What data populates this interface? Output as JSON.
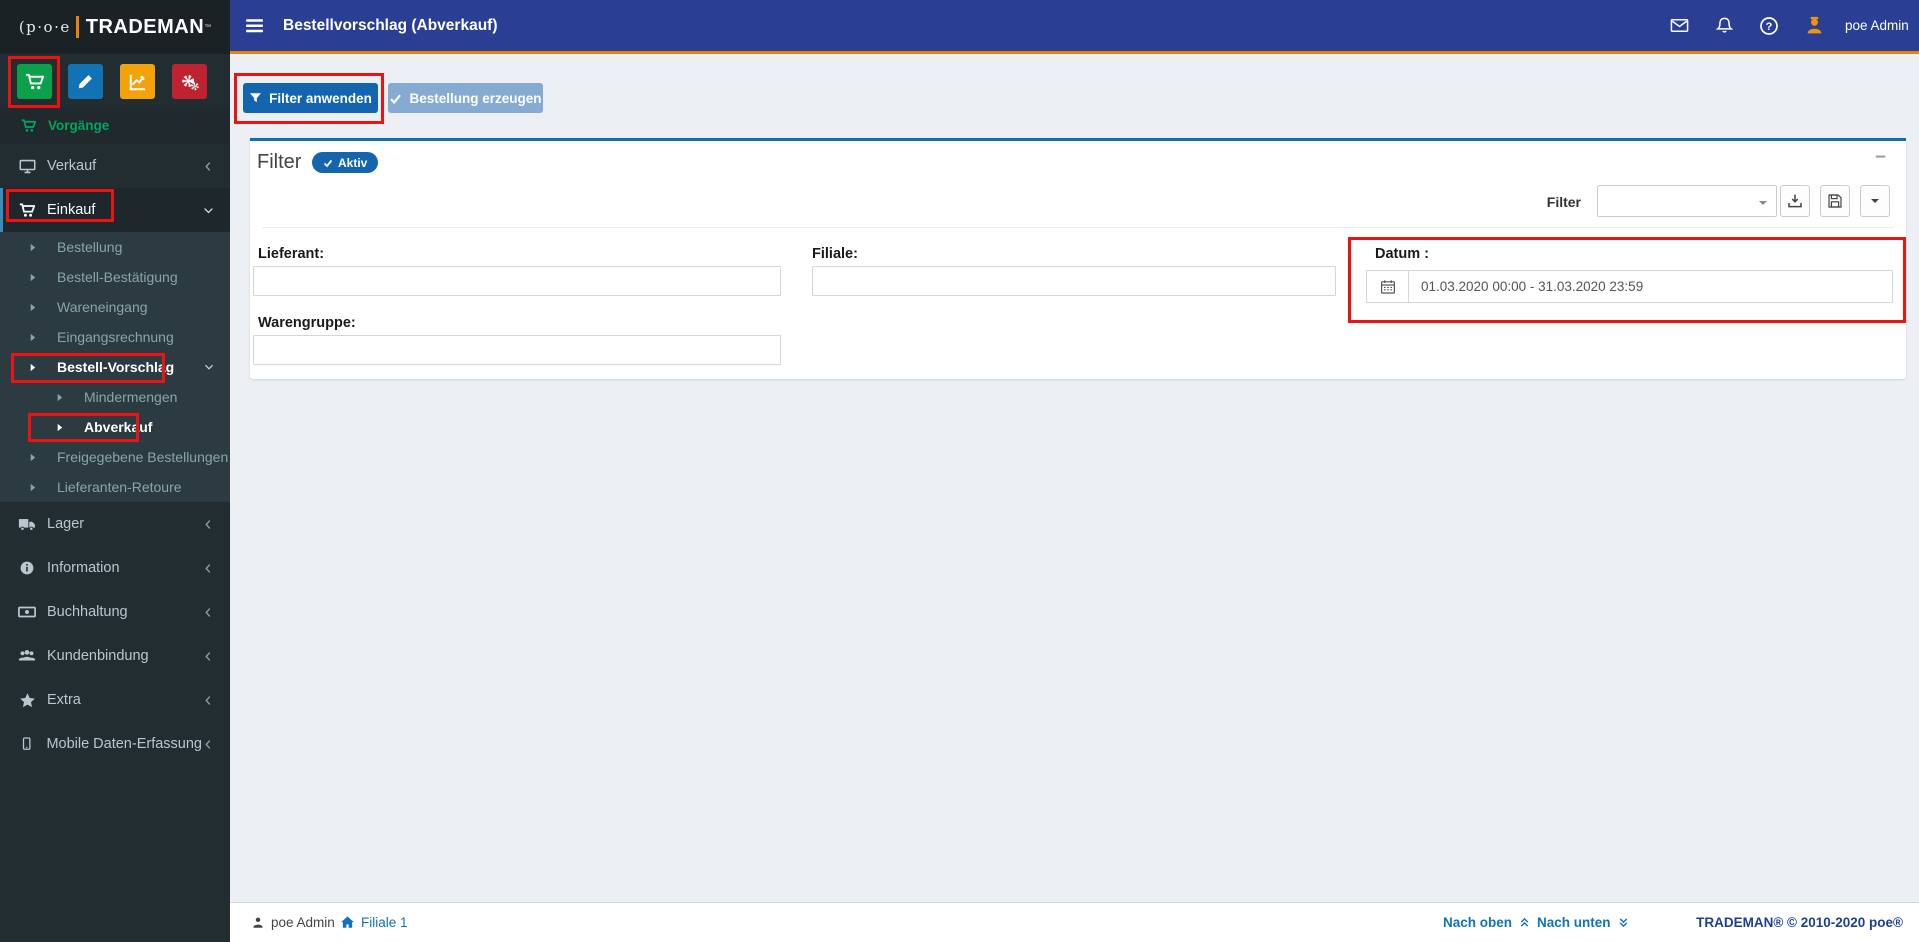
{
  "logo": {
    "mark": "(p·o·e",
    "name": "TRADEMAN",
    "tm": "™"
  },
  "topbar": {
    "title": "Bestellvorschlag (Abverkauf)",
    "user": "poe Admin"
  },
  "sidebar": {
    "section": "Vorgänge",
    "items": [
      {
        "label": "Verkauf"
      },
      {
        "label": "Einkauf"
      },
      {
        "label": "Lager"
      },
      {
        "label": "Information"
      },
      {
        "label": "Buchhaltung"
      },
      {
        "label": "Kundenbindung"
      },
      {
        "label": "Extra"
      },
      {
        "label": "Mobile Daten-Erfassung"
      }
    ],
    "einkauf_sub": [
      "Bestellung",
      "Bestell-Bestätigung",
      "Wareneingang",
      "Eingangsrechnung",
      "Bestell-Vorschlag",
      "Freigegebene Bestellungen",
      "Lieferanten-Retoure"
    ],
    "vorschlag_sub": [
      "Mindermengen",
      "Abverkauf"
    ]
  },
  "toolbar": {
    "apply_filter": "Filter anwenden",
    "create_order": "Bestellung erzeugen"
  },
  "panel": {
    "title": "Filter",
    "badge": "Aktiv",
    "collapse": "−",
    "select_label": "Filter",
    "lieferant_label": "Lieferant:",
    "filiale_label": "Filiale:",
    "warengruppe_label": "Warengruppe:",
    "datum_label": "Datum :",
    "datum_value": "01.03.2020 00:00 - 31.03.2020 23:59"
  },
  "footer": {
    "user": "poe Admin",
    "branch": "Filiale 1",
    "up": "Nach oben",
    "down": "Nach unten",
    "copyright": "TRADEMAN® © 2010-2020 poe®"
  },
  "colors": {
    "topbar_blue": "#2a3f93",
    "accent_orange": "#e8830d",
    "sidebar_dark": "#222d32",
    "sidebar_green": "#00a65a",
    "primary_button": "#1565ae",
    "disabled_button": "#85abd3",
    "panel_border_blue": "#0c6db8",
    "annotation_red": "#ec1313",
    "quick_green": "#0ba04a",
    "quick_blue": "#1272b6",
    "quick_orange": "#f3a20b",
    "quick_red": "#bf2330"
  }
}
